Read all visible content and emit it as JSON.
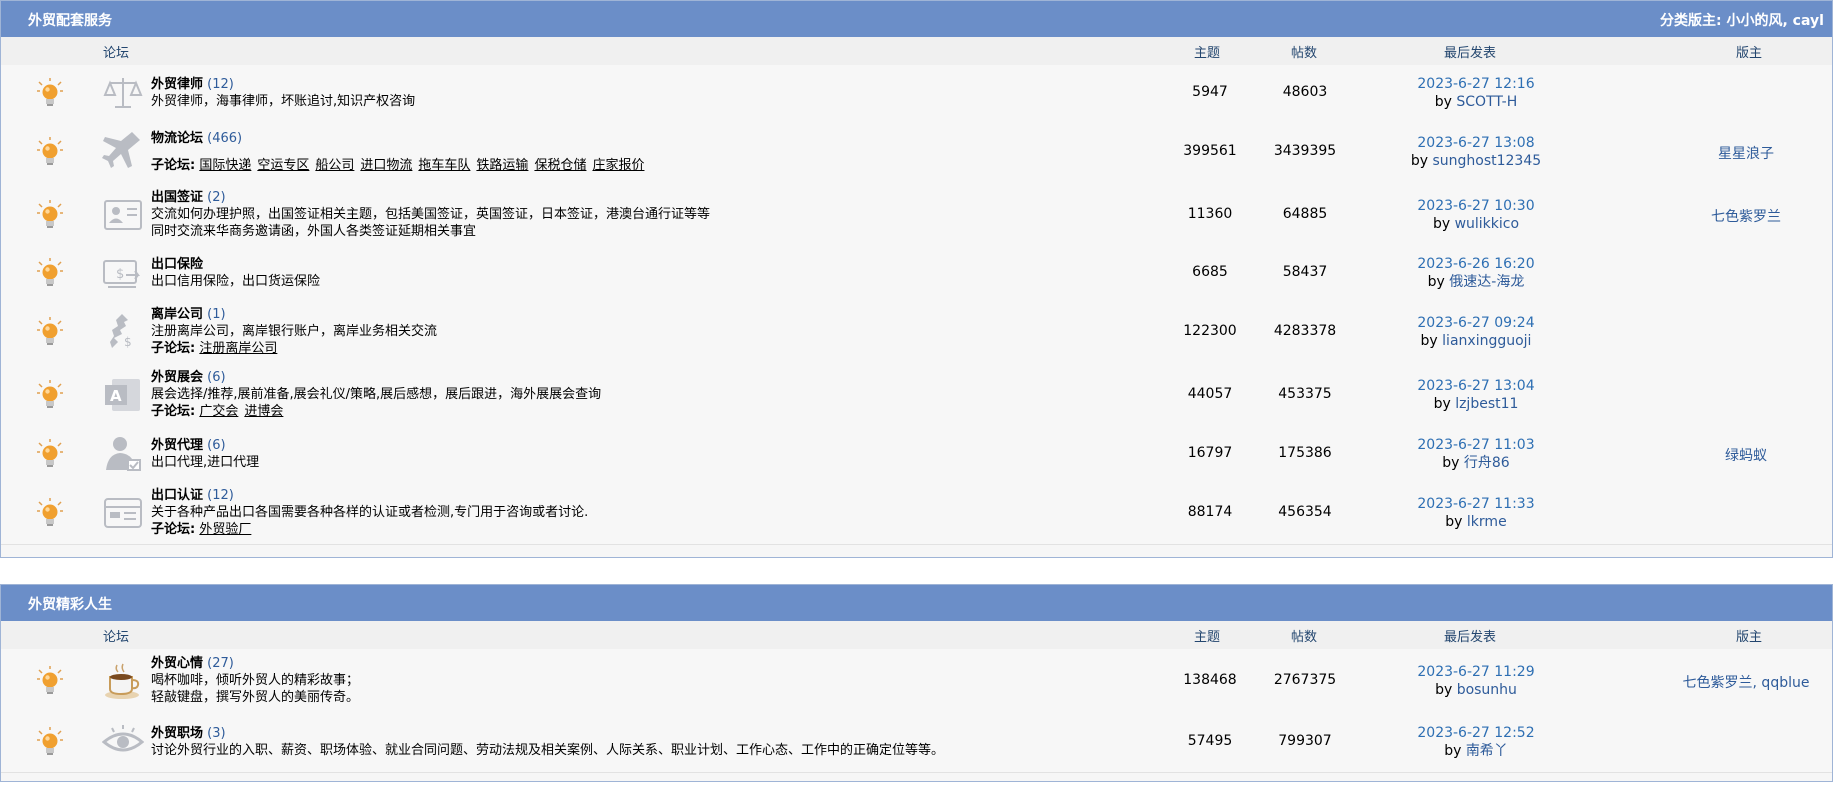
{
  "sections": [
    {
      "title": "外贸配套服务",
      "moderators_label": "分类版主: 小小的风, cayl",
      "columns": {
        "forum": "论坛",
        "topics": "主题",
        "posts": "帖数",
        "last": "最后发表",
        "mod": "版主"
      },
      "forums": [
        {
          "name": "外贸律师",
          "count": "(12)",
          "desc": [
            "外贸律师，海事律师，坏账追讨,知识产权咨询"
          ],
          "subs": [],
          "topics": "5947",
          "posts": "48603",
          "last_time": "2023-6-27 12:16",
          "last_by": "SCOTT-H",
          "mod": "",
          "icon": "scale-icon"
        },
        {
          "name": "物流论坛",
          "count": "(466)",
          "desc": [],
          "subs_label": "子论坛:",
          "subs": [
            "国际快递",
            "空运专区",
            "船公司",
            "进口物流",
            "拖车车队",
            "铁路运输",
            "保税仓储",
            "庄家报价"
          ],
          "topics": "399561",
          "posts": "3439395",
          "last_time": "2023-6-27 13:08",
          "last_by": "sunghost12345",
          "mod": "星星浪子",
          "icon": "airplane-icon"
        },
        {
          "name": "出国签证",
          "count": "(2)",
          "desc": [
            "交流如何办理护照，出国签证相关主题，包括美国签证，英国签证，日本签证，港澳台通行证等等",
            "同时交流来华商务邀请函，外国人各类签证延期相关事宜"
          ],
          "subs": [],
          "topics": "11360",
          "posts": "64885",
          "last_time": "2023-6-27 10:30",
          "last_by": "wulikkico",
          "mod": "七色紫罗兰",
          "icon": "id-card-icon"
        },
        {
          "name": "出口保险",
          "count": "",
          "desc": [
            "出口信用保险，出口货运保险"
          ],
          "subs": [],
          "topics": "6685",
          "posts": "58437",
          "last_time": "2023-6-26 16:20",
          "last_by": "俄速达-海龙",
          "mod": "",
          "icon": "insurance-icon"
        },
        {
          "name": "离岸公司",
          "count": "(1)",
          "desc": [
            "注册离岸公司，离岸银行账户，离岸业务相关交流"
          ],
          "subs_label": "子论坛:",
          "subs": [
            "注册离岸公司"
          ],
          "topics": "122300",
          "posts": "4283378",
          "last_time": "2023-6-27 09:24",
          "last_by": "lianxingguoji",
          "mod": "",
          "icon": "money-icon"
        },
        {
          "name": "外贸展会",
          "count": "(6)",
          "desc": [
            "展会选择/推荐,展前准备,展会礼仪/策略,展后感想，展后跟进，海外展展会查询"
          ],
          "subs_label": "子论坛:",
          "subs": [
            "广交会",
            "进博会"
          ],
          "topics": "44057",
          "posts": "453375",
          "last_time": "2023-6-27 13:04",
          "last_by": "lzjbest11",
          "mod": "",
          "icon": "exhibition-icon"
        },
        {
          "name": "外贸代理",
          "count": "(6)",
          "desc": [
            "出口代理,进口代理"
          ],
          "subs": [],
          "topics": "16797",
          "posts": "175386",
          "last_time": "2023-6-27 11:03",
          "last_by": "行舟86",
          "mod": "绿蚂蚁",
          "icon": "agent-icon"
        },
        {
          "name": "出口认证",
          "count": "(12)",
          "desc": [
            "关于各种产品出口各国需要各种各样的认证或者检测,专门用于咨询或者讨论."
          ],
          "subs_label": "子论坛:",
          "subs": [
            "外贸验厂"
          ],
          "topics": "88174",
          "posts": "456354",
          "last_time": "2023-6-27 11:33",
          "last_by": "lkrme",
          "mod": "",
          "icon": "certificate-icon"
        }
      ]
    },
    {
      "title": "外贸精彩人生",
      "columns": {
        "forum": "论坛",
        "topics": "主题",
        "posts": "帖数",
        "last": "最后发表",
        "mod": "版主"
      },
      "forums": [
        {
          "name": "外贸心情",
          "count": "(27)",
          "desc": [
            "喝杯咖啡，倾听外贸人的精彩故事；",
            "轻敲键盘，撰写外贸人的美丽传奇。"
          ],
          "subs": [],
          "topics": "138468",
          "posts": "2767375",
          "last_time": "2023-6-27 11:29",
          "last_by": "bosunhu",
          "mod": "七色紫罗兰, qqblue",
          "icon": "coffee-icon"
        },
        {
          "name": "外贸职场",
          "count": "(3)",
          "desc": [
            "讨论外贸行业的入职、薪资、职场体验、就业合同问题、劳动法规及相关案例、人际关系、职业计划、工作心态、工作中的正确定位等等。"
          ],
          "subs": [],
          "topics": "57495",
          "posts": "799307",
          "last_time": "2023-6-27 12:52",
          "last_by": "南希丫",
          "mod": "",
          "icon": "eye-icon"
        }
      ]
    }
  ]
}
